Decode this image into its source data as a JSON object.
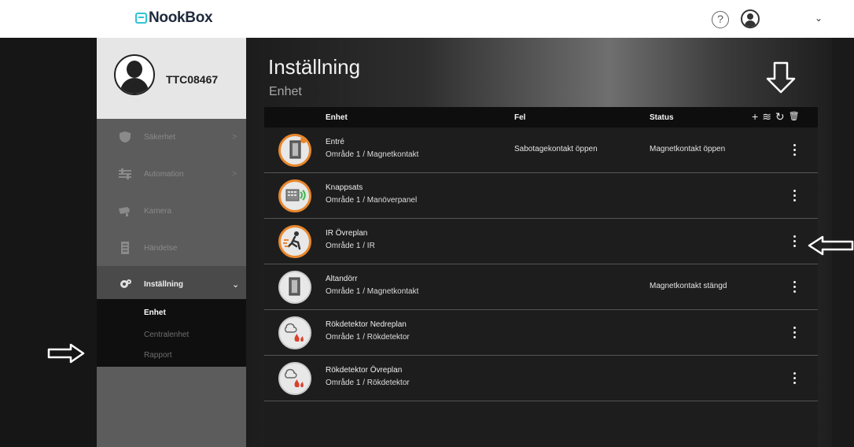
{
  "app": {
    "logo": "NookBox"
  },
  "header": {
    "help_icon": "question-circle-icon",
    "user_icon": "user-circle-icon",
    "dropdown_icon": "chevron-down-icon"
  },
  "profile": {
    "username": "TTC08467"
  },
  "sidebar": {
    "items": [
      {
        "label": "Säkerhet",
        "icon": "shield-icon",
        "chevron": ">"
      },
      {
        "label": "Automation",
        "icon": "sliders-icon",
        "chevron": ">"
      },
      {
        "label": "Kamera",
        "icon": "camera-icon",
        "chevron": ""
      },
      {
        "label": "Händelse",
        "icon": "list-icon",
        "chevron": ""
      },
      {
        "label": "Inställning",
        "icon": "gear-icon",
        "chevron": "⌄"
      }
    ],
    "submenu": [
      "Enhet",
      "Centralenhet",
      "Rapport"
    ]
  },
  "main": {
    "title": "Inställning",
    "subtitle": "Enhet"
  },
  "table": {
    "headers": {
      "device": "Enhet",
      "fault": "Fel",
      "status": "Status"
    },
    "actions": [
      "+",
      "≋",
      "↻",
      "🗑"
    ],
    "rows": [
      {
        "name": "Entré",
        "sub": "Område 1 / Magnetkontakt",
        "fault": "Sabotagekontakt öppen",
        "status": "Magnetkontakt öppen",
        "icon": "door-contact-icon"
      },
      {
        "name": "Knappsats",
        "sub": "Område 1 / Manöverpanel",
        "fault": "",
        "status": "",
        "icon": "keypad-icon"
      },
      {
        "name": "IR Övreplan",
        "sub": "Område 1 / IR",
        "fault": "",
        "status": "",
        "icon": "motion-sensor-icon"
      },
      {
        "name": "Altandörr",
        "sub": "Område 1 / Magnetkontakt",
        "fault": "",
        "status": "Magnetkontakt stängd",
        "icon": "door-contact-icon"
      },
      {
        "name": "Rökdetektor Nedreplan",
        "sub": "Område 1 / Rökdetektor",
        "fault": "",
        "status": "",
        "icon": "smoke-detector-icon"
      },
      {
        "name": "Rökdetektor Övreplan",
        "sub": "Område 1 / Rökdetektor",
        "fault": "",
        "status": "",
        "icon": "smoke-detector-icon"
      }
    ]
  },
  "colors": {
    "accent": "#2ec4d6",
    "warning": "#e8872d",
    "panel": "#5c5c5c"
  }
}
